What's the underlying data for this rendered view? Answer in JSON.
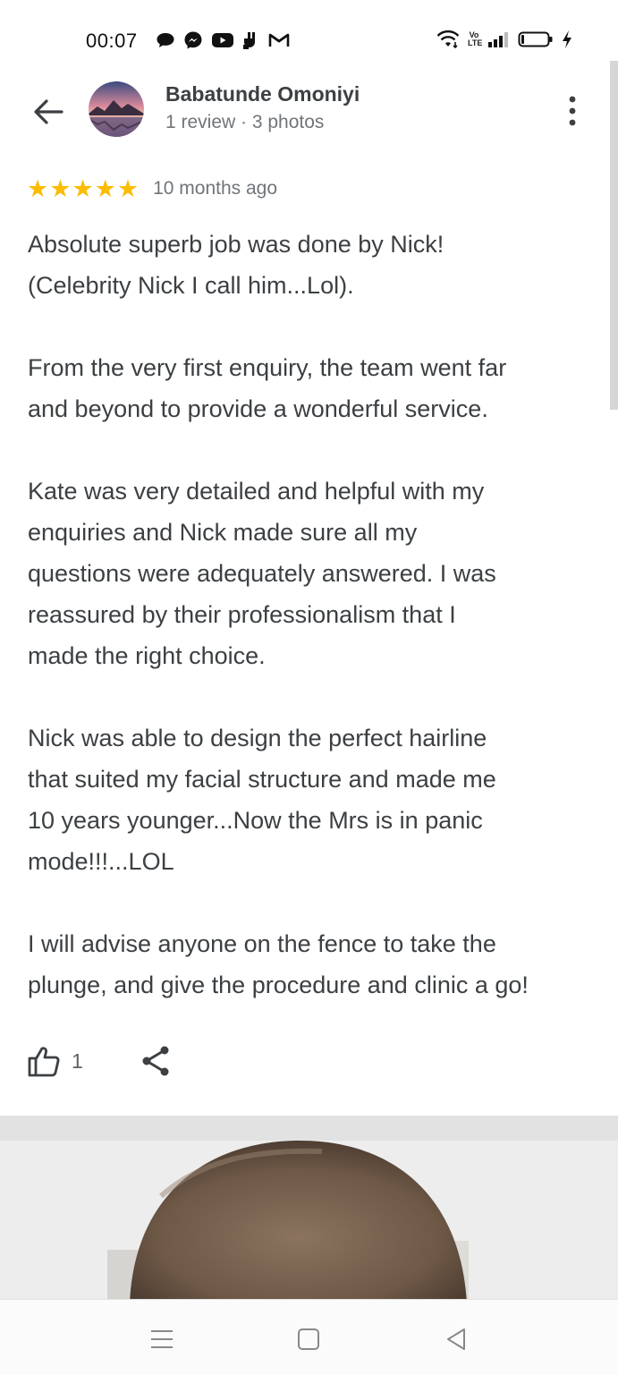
{
  "status_bar": {
    "time": "00:07",
    "left_icons": [
      "chat-bubble-icon",
      "messenger-icon",
      "youtube-icon",
      "app-icon",
      "gmail-icon"
    ],
    "right_icons": [
      "wifi-icon",
      "volte-icon",
      "signal-icon",
      "battery-icon",
      "charging-icon"
    ],
    "volte_top": "Vo",
    "volte_bottom": "LTE"
  },
  "header": {
    "back_icon": "arrow-left-icon",
    "reviewer_name": "Babatunde Omoniyi",
    "reviewer_meta": "1 review · 3 photos",
    "more_icon": "more-vert-icon"
  },
  "review": {
    "rating": 5,
    "stars": [
      "★",
      "★",
      "★",
      "★",
      "★"
    ],
    "date": "10 months ago",
    "paragraphs": [
      "Absolute superb job was done by Nick!\n(Celebrity Nick I call him...Lol).",
      "From the very first enquiry, the team went far\nand beyond to provide a wonderful service.",
      "Kate was very detailed and helpful with my\nenquiries and Nick made sure all my\nquestions were adequately answered. I was\nreassured by their professionalism that I\nmade the right choice.",
      "Nick was able to design the perfect hairline\nthat suited my facial structure and made me\n10 years younger...Now the Mrs is in panic\nmode!!!...LOL",
      "I will advise anyone on the fence to take the\nplunge, and give the procedure and clinic a go!"
    ],
    "like_count": "1"
  },
  "colors": {
    "star": "#fbbc04",
    "text": "#3c4043",
    "secondary_text": "#70757a"
  },
  "nav_bar": {
    "icons": [
      "menu-icon",
      "home-square-icon",
      "back-triangle-icon"
    ]
  }
}
